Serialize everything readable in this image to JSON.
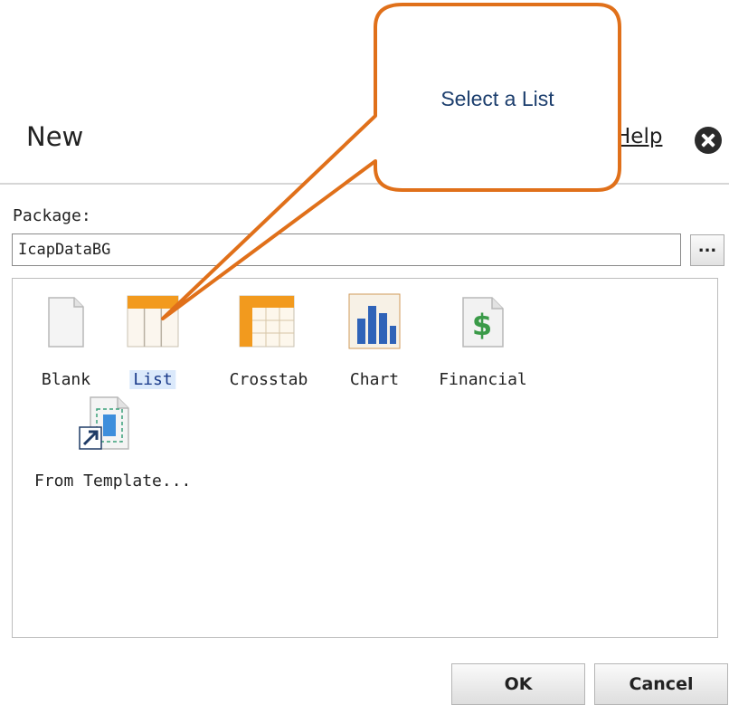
{
  "dialog": {
    "title": "New",
    "help_label": "Help"
  },
  "package": {
    "label": "Package:",
    "value": "IcapDataBG",
    "browse_label": "..."
  },
  "items": [
    {
      "label": "Blank"
    },
    {
      "label": "List"
    },
    {
      "label": "Crosstab"
    },
    {
      "label": "Chart"
    },
    {
      "label": "Financial"
    },
    {
      "label": "From Template..."
    }
  ],
  "buttons": {
    "ok_label": "OK",
    "cancel_label": "Cancel"
  },
  "callout": {
    "text": "Select a List",
    "border_color": "#e0701a"
  },
  "colors": {
    "selected_text": "#1a3a8a",
    "selected_bg": "#dbe9fb",
    "list_header": "#f29a1e"
  }
}
